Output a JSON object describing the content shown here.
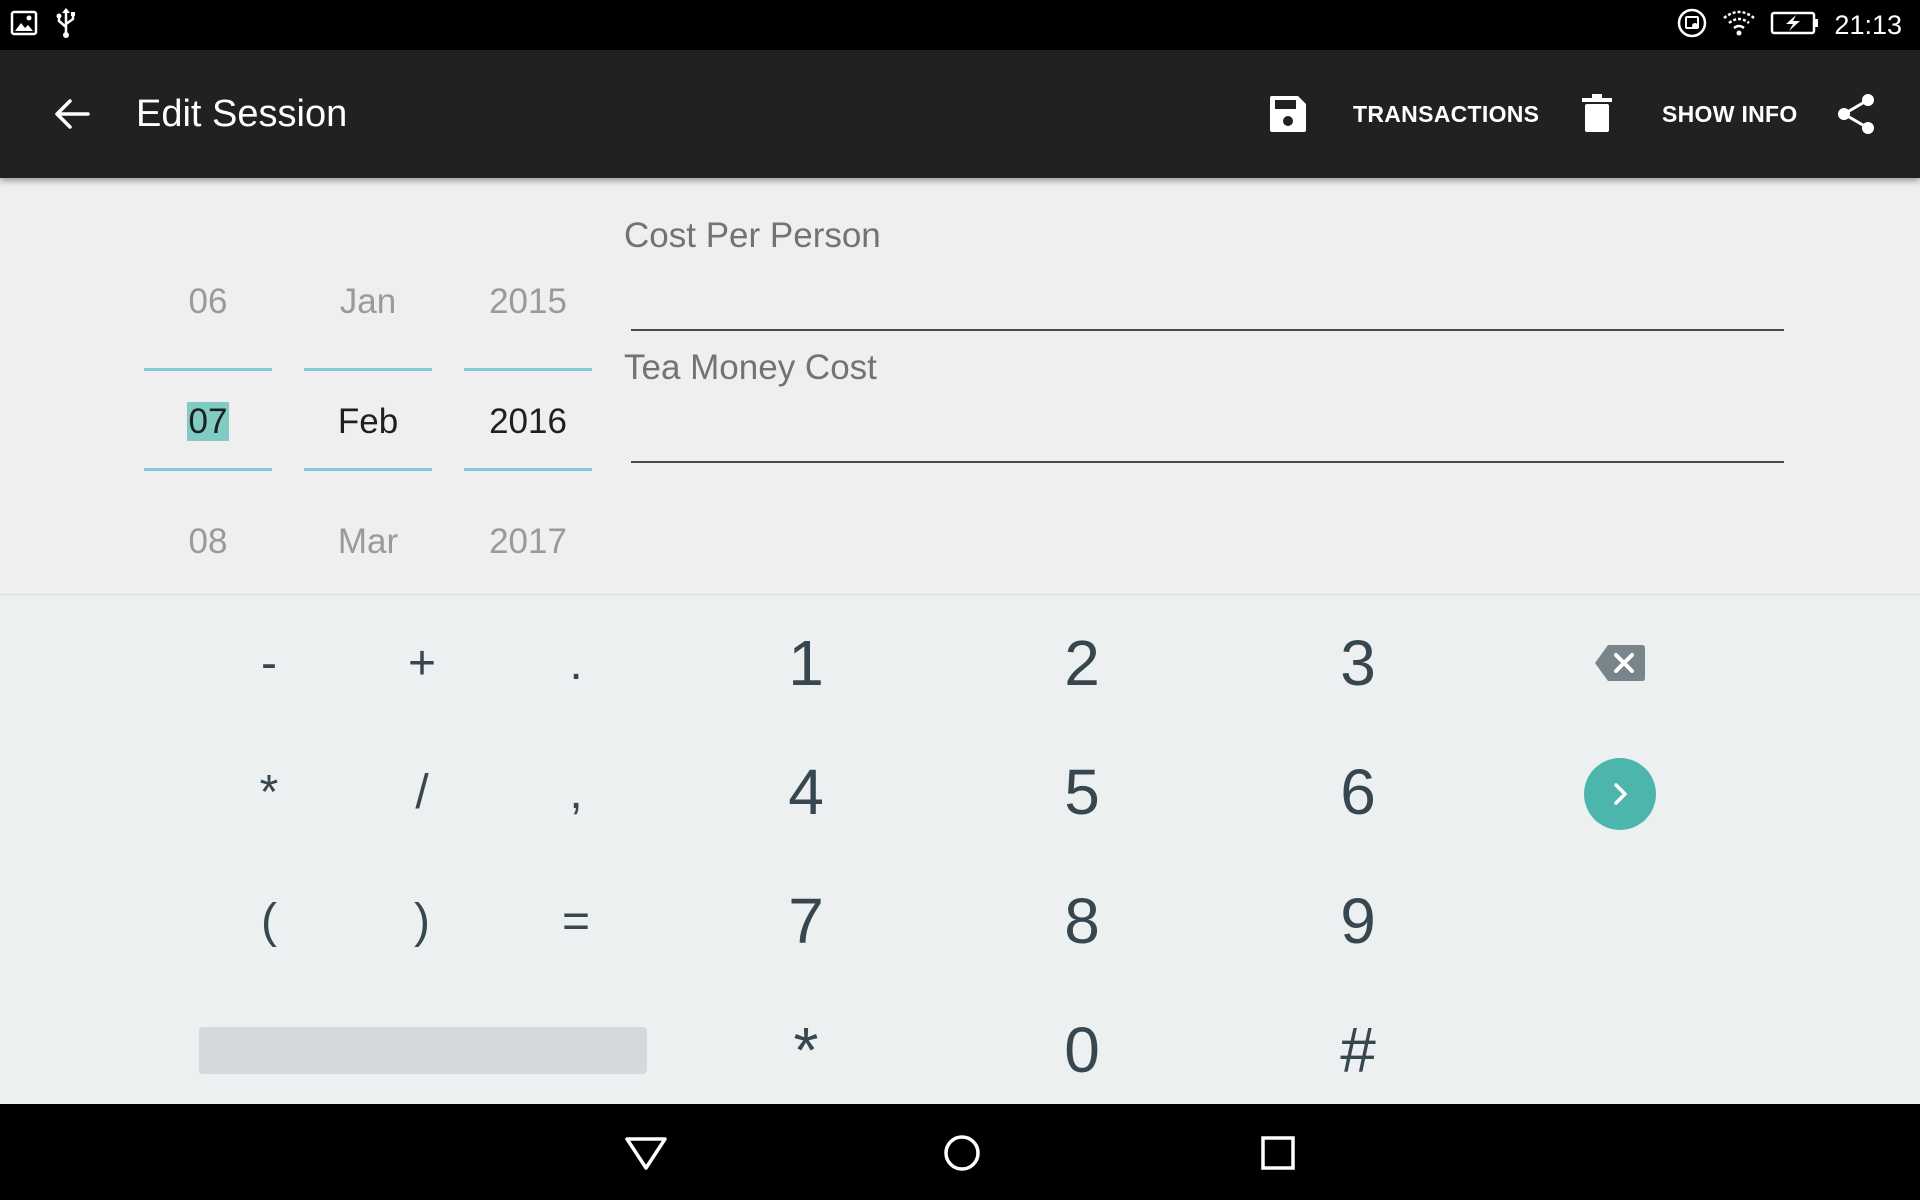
{
  "status_bar": {
    "time": "21:13",
    "icons_left": [
      "image-icon",
      "usb-icon"
    ],
    "icons_right": [
      "cast-icon",
      "wifi-icon",
      "battery-charging-icon"
    ]
  },
  "app_bar": {
    "title": "Edit Session",
    "actions": {
      "save_icon": "save-icon",
      "transactions_label": "TRANSACTIONS",
      "delete_icon": "delete-icon",
      "show_info_label": "SHOW INFO",
      "share_icon": "share-icon"
    }
  },
  "date_picker": {
    "day": {
      "prev": "06",
      "selected": "07",
      "next": "08"
    },
    "month": {
      "prev": "Jan",
      "selected": "Feb",
      "next": "Mar"
    },
    "year": {
      "prev": "2015",
      "selected": "2016",
      "next": "2017"
    }
  },
  "fields": {
    "cost_per_person": {
      "label": "Cost Per Person",
      "value": ""
    },
    "tea_money_cost": {
      "label": "Tea Money Cost",
      "value": ""
    }
  },
  "keypad": {
    "symbols": {
      "minus": "-",
      "plus": "+",
      "period": ".",
      "asterisk": "*",
      "slash": "/",
      "comma": ",",
      "lparen": "(",
      "rparen": ")",
      "equals": "="
    },
    "numbers": {
      "n1": "1",
      "n2": "2",
      "n3": "3",
      "n4": "4",
      "n5": "5",
      "n6": "6",
      "n7": "7",
      "n8": "8",
      "n9": "9",
      "star": "*",
      "n0": "0",
      "hash": "#"
    },
    "accent_color": "#4db6ac"
  },
  "colors": {
    "app_bar": "#212121",
    "picker_line": "#7fc9dc",
    "selection_highlight": "#80cbc4"
  }
}
